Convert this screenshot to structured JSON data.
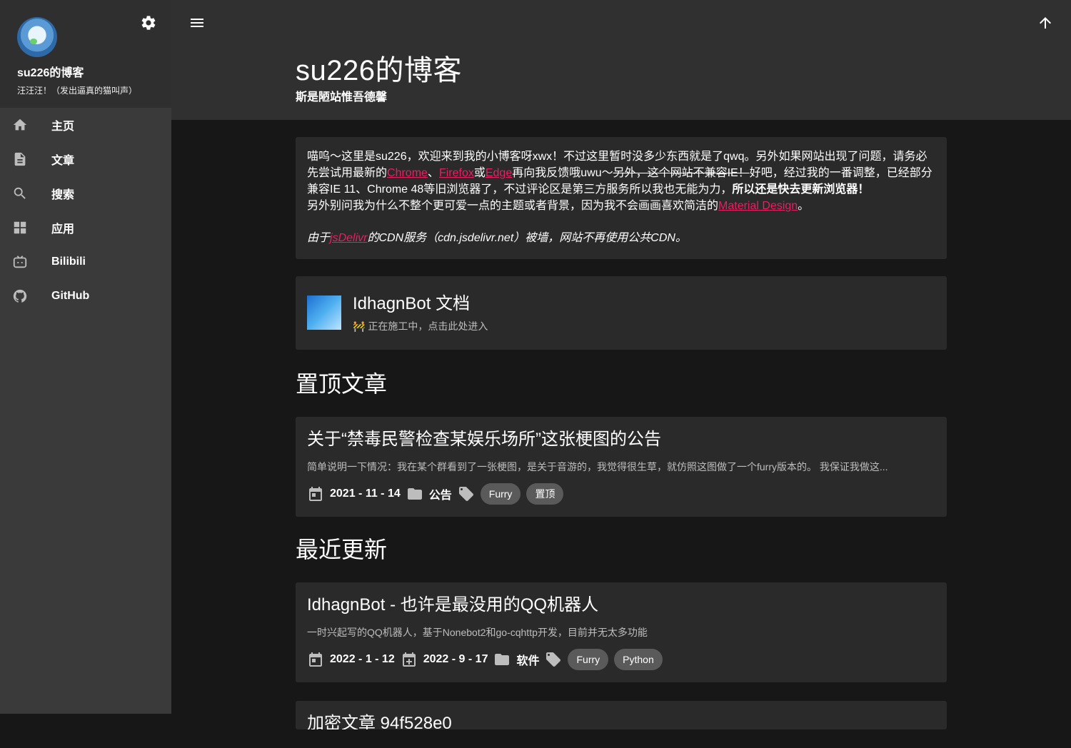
{
  "sidebar": {
    "title": "su226的博客",
    "subtitle": "汪汪汪！（发出逼真的猫叫声）",
    "items": [
      {
        "label": "主页",
        "icon": "home-icon"
      },
      {
        "label": "文章",
        "icon": "article-icon"
      },
      {
        "label": "搜索",
        "icon": "search-icon"
      },
      {
        "label": "应用",
        "icon": "apps-icon"
      },
      {
        "label": "Bilibili",
        "icon": "bilibili-icon"
      },
      {
        "label": "GitHub",
        "icon": "github-icon"
      }
    ]
  },
  "header": {
    "title": "su226的博客",
    "subtitle": "斯是陋站惟吾德馨"
  },
  "notice": {
    "p1a": "喵呜～这里是su226，欢迎来到我的小博客呀xwx！不过这里暂时没多少东西就是了qwq。另外如果网站出现了问题，请务必先尝试用最新的",
    "chrome": "Chrome",
    "sep1": "、",
    "firefox": "Firefox",
    "sep2": "或",
    "edge": "Edge",
    "p1b": "再向我反馈哦uwu～",
    "strike": "另外，这个网站不兼容IE！",
    "p1c": "好吧，经过我的一番调整，已经部分兼容IE 11、Chrome 48等旧浏览器了，不过评论区是第三方服务所以我也无能为力，",
    "bold": "所以还是快去更新浏览器！",
    "p2a": "另外别问我为什么不整个更可爱一点的主题或者背景，因为我不会画画喜欢简洁的",
    "md": "Material Design",
    "p2b": "。",
    "i1": "由于",
    "jsdelivr": "jsDelivr",
    "i2": "的CDN服务（cdn.jsdelivr.net）被墙，网站不再使用公共CDN。"
  },
  "bot": {
    "title": "IdhagnBot 文档",
    "sub": "🚧 正在施工中，点击此处进入"
  },
  "sections": {
    "pinned": "置顶文章",
    "recent": "最近更新"
  },
  "pinned_post": {
    "title": "关于“禁毒民警检查某娱乐场所”这张梗图的公告",
    "excerpt": "简单说明一下情况：我在某个群看到了一张梗图，是关于音游的，我觉得很生草，就仿照这图做了一个furry版本的。 我保证我做这...",
    "date": "2021 - 11 - 14",
    "category": "公告",
    "tags": [
      "Furry",
      "置顶"
    ]
  },
  "recent_post": {
    "title": "IdhagnBot - 也许是最没用的QQ机器人",
    "excerpt": "一时兴起写的QQ机器人，基于Nonebot2和go-cqhttp开发，目前并无太多功能",
    "date": "2022 - 1 - 12",
    "updated": "2022 - 9 - 17",
    "category": "软件",
    "tags": [
      "Furry",
      "Python"
    ]
  },
  "partial_post": {
    "title": "加密文章 94f528e0"
  }
}
